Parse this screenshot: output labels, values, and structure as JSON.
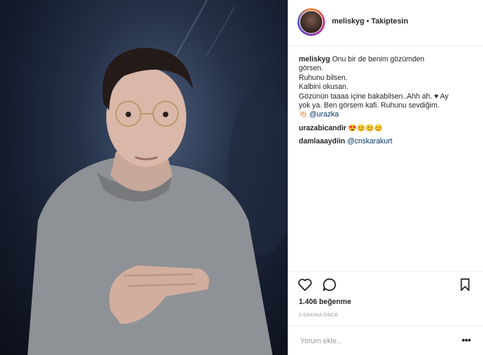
{
  "header": {
    "username": "meliskyg",
    "separator": "•",
    "follow_status": "Takiptesin"
  },
  "comments": {
    "caption": {
      "user": "meliskyg",
      "lines": [
        "Onu bir de benim gözümden",
        "görsen.",
        "Ruhunu bilsen.",
        "Kalbini okusan.",
        "Gözünün taaaa içine bakabilsen..Ahh ah. ♥ Ay",
        "yok ya. Ben görsem kafi. Ruhunu sevdiğim."
      ],
      "tag_emoji": "👏🏻",
      "mention": "@urazka"
    },
    "comment2": {
      "user": "urazabicandir",
      "text": "😍😊😊😊"
    },
    "comment3": {
      "user": "damlaaaydiin",
      "mention": "@cnskarakurt"
    }
  },
  "actions": {
    "icons": [
      "heart-icon",
      "comment-icon",
      "bookmark-icon"
    ],
    "likes": "1.406 beğenme",
    "time": "5 DAKİKA ÖNCE",
    "comment_placeholder": "Yorum ekle...",
    "more": "•••"
  }
}
